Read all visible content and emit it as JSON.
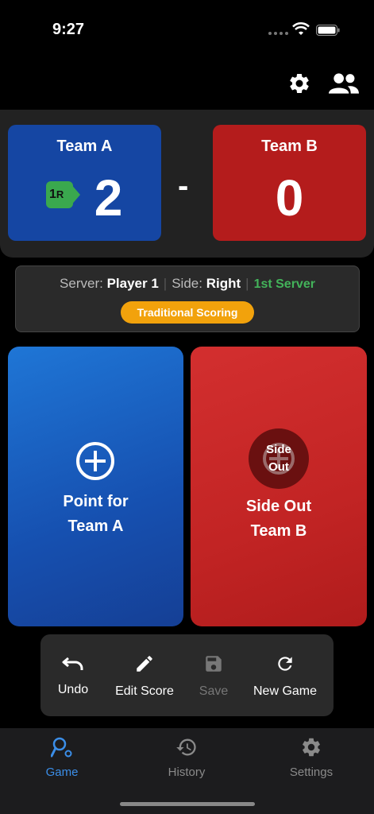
{
  "status": {
    "time": "9:27"
  },
  "colors": {
    "team_a": "#1546a3",
    "team_b": "#b41c1c",
    "accent": "#3b8ee8",
    "server_green": "#43b35a",
    "pill": "#f2a20c"
  },
  "top_icons": [
    "gear-icon",
    "people-icon"
  ],
  "scoreboard": {
    "team_a": {
      "name": "Team A",
      "score": "2",
      "badge_num": "1",
      "badge_side": "R"
    },
    "separator": "-",
    "team_b": {
      "name": "Team B",
      "score": "0"
    }
  },
  "info": {
    "server_label": "Server:",
    "server_value": "Player 1",
    "side_label": "Side:",
    "side_value": "Right",
    "server_order": "1st Server",
    "scoring_mode": "Traditional Scoring"
  },
  "actions": {
    "point_line1": "Point for",
    "point_line2": "Team A",
    "sideout_icon_line1": "Side",
    "sideout_icon_line2": "Out",
    "sideout_line1": "Side Out",
    "sideout_line2": "Team B"
  },
  "toolbar": {
    "undo": "Undo",
    "edit": "Edit Score",
    "save": "Save",
    "new_game": "New Game"
  },
  "tabs": {
    "game": "Game",
    "history": "History",
    "settings": "Settings"
  }
}
